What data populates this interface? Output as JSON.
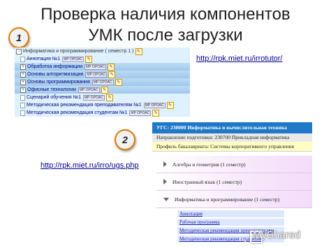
{
  "title": {
    "line1": "Проверка наличия компонентов",
    "line2": "УМК после загрузки"
  },
  "badges": {
    "one": "1",
    "two": "2"
  },
  "urls": {
    "first": "http://rpk.miet.ru/irrotutor/",
    "second": "http://rpk.miet.ru/irro/ugs.php"
  },
  "tree": {
    "top": "Информатика и программирование ( семестр 1 )",
    "items": [
      {
        "label": "Аннотация №1",
        "tag": "MP OPOAC",
        "kind": "doc"
      },
      {
        "label": "Обработка информации",
        "tag": "MP OPOAC",
        "kind": "folder"
      },
      {
        "label": "Основы алгоритмизации",
        "tag": "MP OPOAC",
        "kind": "folder"
      },
      {
        "label": "Основы программирования",
        "tag": "MP OPOAC",
        "kind": "folder"
      },
      {
        "label": "Офисные технологии",
        "tag": "MP OPOAC",
        "kind": "folder"
      },
      {
        "label": "Сценарий обучения №1",
        "tag": "MP OPOAC",
        "kind": "doc"
      },
      {
        "label": "Методическая рекомендация преподавателям №1",
        "tag": "MP OPOAC",
        "kind": "doc"
      },
      {
        "label": "Методическая рекомендация студентам №1",
        "tag": "MP OPOAC",
        "kind": "doc"
      }
    ]
  },
  "pane2": {
    "header": "УГС: 230000 Информатика и вычислительная техника",
    "direction": "Направление подготовки: 230700 Прикладная информатика",
    "profile": "Профиль бакалавриата: Системы корпоративного управления",
    "subjects": [
      {
        "label": "Алгебра и геометрия (1 семестр)"
      },
      {
        "label": "Иностранный язык (1 семестр)"
      },
      {
        "label": "Информатика и программирование (1 семестр)"
      }
    ],
    "links": [
      "Аннотация",
      "Рабочая программа",
      "Методическая рекомендация преподавателям",
      "Методическая рекомендация студентам"
    ]
  },
  "watermark": "MyShared"
}
